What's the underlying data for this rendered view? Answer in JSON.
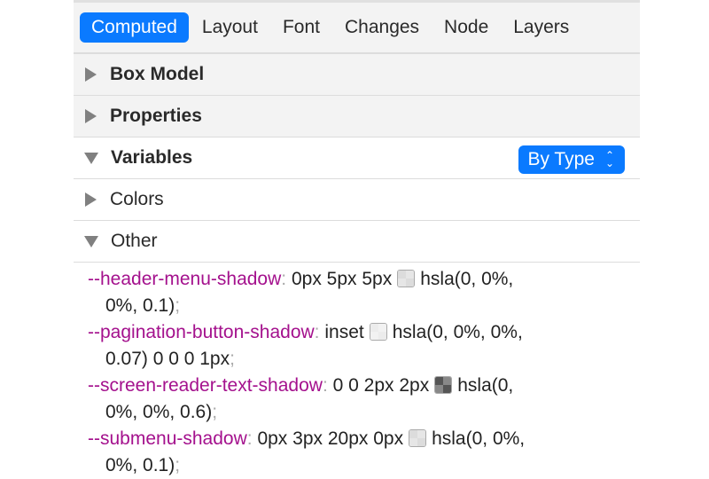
{
  "tabs": [
    {
      "label": "Computed",
      "active": true
    },
    {
      "label": "Layout"
    },
    {
      "label": "Font"
    },
    {
      "label": "Changes"
    },
    {
      "label": "Node"
    },
    {
      "label": "Layers"
    }
  ],
  "sections": [
    {
      "title": "Box Model",
      "expanded": false
    },
    {
      "title": "Properties",
      "expanded": false
    },
    {
      "title": "Variables",
      "expanded": true,
      "control": "By Type"
    },
    {
      "title": "Colors",
      "expanded": false
    },
    {
      "title": "Other",
      "expanded": true
    }
  ],
  "variables": [
    {
      "name": "--header-menu-shadow",
      "before": "0px 5px 5px",
      "after": "hsla(0, 0%,",
      "cont": "0%, 0.1)",
      "swatch": "#dcdcdc"
    },
    {
      "name": "--pagination-button-shadow",
      "before": "inset",
      "after": "hsla(0, 0%, 0%,",
      "cont": "0.07) 0 0 0 1px",
      "swatch": "#ececec"
    },
    {
      "name": "--screen-reader-text-shadow",
      "before": "0 0 2px 2px",
      "after": "hsla(0,",
      "cont": "0%, 0%, 0.6)",
      "swatch": "#555555"
    },
    {
      "name": "--submenu-shadow",
      "before": "0px 3px 20px 0px",
      "after": "hsla(0, 0%,",
      "cont": "0%, 0.1)",
      "swatch": "#dcdcdc"
    }
  ],
  "punct": {
    "colon": ":",
    "semicolon": ";"
  },
  "colors": {
    "accent": "#0a7aff",
    "var_name": "#a4118d"
  }
}
